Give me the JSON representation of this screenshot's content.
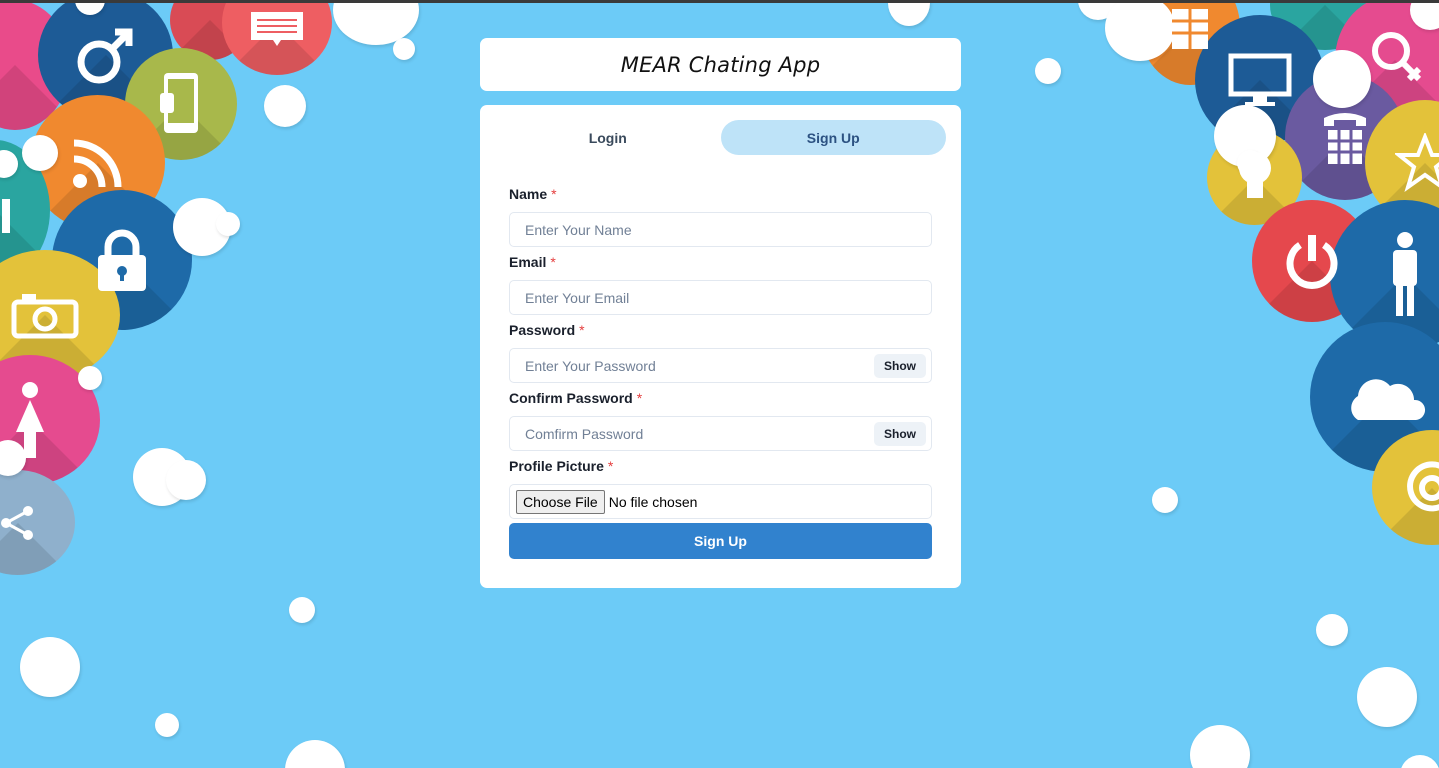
{
  "app_title": "MEAR Chating App",
  "tabs": [
    {
      "label": "Login",
      "active": false
    },
    {
      "label": "Sign Up",
      "active": true
    }
  ],
  "form": {
    "name": {
      "label": "Name",
      "required_mark": "*",
      "placeholder": "Enter Your Name",
      "value": ""
    },
    "email": {
      "label": "Email",
      "required_mark": "*",
      "placeholder": "Enter Your Email",
      "value": ""
    },
    "password": {
      "label": "Password",
      "required_mark": "*",
      "placeholder": "Enter Your Password",
      "value": "",
      "toggle_label": "Show"
    },
    "confirm_password": {
      "label": "Confirm Password",
      "required_mark": "*",
      "placeholder": "Comfirm Password",
      "value": "",
      "toggle_label": "Show"
    },
    "profile_picture": {
      "label": "Profile Picture",
      "required_mark": "*",
      "button_label": "Choose File",
      "status": "No file chosen"
    },
    "submit_label": "Sign Up"
  },
  "colors": {
    "background": "#6ccbf7",
    "active_tab": "#bee3f8",
    "primary_button": "#3182ce",
    "required_mark": "#e53e3e"
  },
  "background_icons": [
    "male-symbol-icon",
    "tablet-icon",
    "rss-icon",
    "lock-icon",
    "camera-icon",
    "female-person-icon",
    "share-icon",
    "bar-chart-icon",
    "monitor-icon",
    "female-symbol-icon",
    "telephone-icon",
    "lightbulb-icon",
    "star-icon",
    "power-icon",
    "male-person-icon",
    "cloud-icon",
    "at-sign-icon"
  ]
}
